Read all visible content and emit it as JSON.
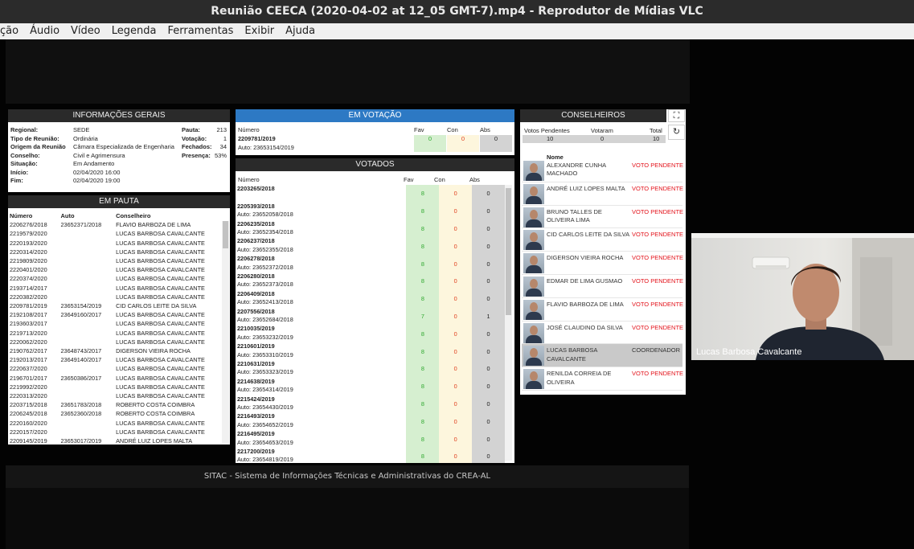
{
  "window": {
    "title": "Reunião CEECA (2020-04-02 at 12_05 GMT-7).mp4 - Reprodutor de Mídias VLC"
  },
  "menu": [
    "ção",
    "Áudio",
    "Vídeo",
    "Legenda",
    "Ferramentas",
    "Exibir",
    "Ajuda"
  ],
  "info": {
    "title": "INFORMAÇÕES GERAIS",
    "left": [
      {
        "label": "Regional:",
        "value": "SEDE"
      },
      {
        "label": "Tipo de Reunião:",
        "value": "Ordinária"
      },
      {
        "label": "Origem da Reunião",
        "value": "Câmara Especializada de Engenharia"
      },
      {
        "label": "Conselho:",
        "value": "Civil e Agrimensura"
      },
      {
        "label": "Situação:",
        "value": "Em Andamento"
      },
      {
        "label": "Início:",
        "value": "02/04/2020 16:00"
      },
      {
        "label": "Fim:",
        "value": "02/04/2020 19:00"
      }
    ],
    "right": [
      {
        "label": "Pauta:",
        "value": "213"
      },
      {
        "label": "Votação:",
        "value": "1"
      },
      {
        "label": "Fechados:",
        "value": "34"
      },
      {
        "label": "Presença:",
        "value": "53%"
      }
    ]
  },
  "pauta": {
    "title": "EM PAUTA",
    "headers": [
      "Número",
      "Auto",
      "Conselheiro"
    ],
    "rows": [
      [
        "2206276/2018",
        "23652371/2018",
        "FLAVIO BARBOZA DE LIMA"
      ],
      [
        "2219579/2020",
        "",
        "LUCAS BARBOSA CAVALCANTE"
      ],
      [
        "2220193/2020",
        "",
        "LUCAS BARBOSA CAVALCANTE"
      ],
      [
        "2220314/2020",
        "",
        "LUCAS BARBOSA CAVALCANTE"
      ],
      [
        "2219809/2020",
        "",
        "LUCAS BARBOSA CAVALCANTE"
      ],
      [
        "2220401/2020",
        "",
        "LUCAS BARBOSA CAVALCANTE"
      ],
      [
        "2220374/2020",
        "",
        "LUCAS BARBOSA CAVALCANTE"
      ],
      [
        "2193714/2017",
        "",
        "LUCAS BARBOSA CAVALCANTE"
      ],
      [
        "2220382/2020",
        "",
        "LUCAS BARBOSA CAVALCANTE"
      ],
      [
        "2209781/2019",
        "23653154/2019",
        "CID CARLOS LEITE DA SILVA"
      ],
      [
        "2192108/2017",
        "23649160/2017",
        "LUCAS BARBOSA CAVALCANTE"
      ],
      [
        "2193603/2017",
        "",
        "LUCAS BARBOSA CAVALCANTE"
      ],
      [
        "2219713/2020",
        "",
        "LUCAS BARBOSA CAVALCANTE"
      ],
      [
        "2220062/2020",
        "",
        "LUCAS BARBOSA CAVALCANTE"
      ],
      [
        "2190762/2017",
        "23648743/2017",
        "DIGERSON VIEIRA ROCHA"
      ],
      [
        "2192013/2017",
        "23649140/2017",
        "LUCAS BARBOSA CAVALCANTE"
      ],
      [
        "2220637/2020",
        "",
        "LUCAS BARBOSA CAVALCANTE"
      ],
      [
        "2196701/2017",
        "23650386/2017",
        "LUCAS BARBOSA CAVALCANTE"
      ],
      [
        "2219992/2020",
        "",
        "LUCAS BARBOSA CAVALCANTE"
      ],
      [
        "2220313/2020",
        "",
        "LUCAS BARBOSA CAVALCANTE"
      ],
      [
        "2203715/2018",
        "23651783/2018",
        "ROBERTO COSTA COIMBRA"
      ],
      [
        "2206245/2018",
        "23652360/2018",
        "ROBERTO COSTA COIMBRA"
      ],
      [
        "2220160/2020",
        "",
        "LUCAS BARBOSA CAVALCANTE"
      ],
      [
        "2220157/2020",
        "",
        "LUCAS BARBOSA CAVALCANTE"
      ],
      [
        "2209145/2019",
        "23653017/2019",
        "ANDRÉ LUIZ LOPES MALTA"
      ]
    ]
  },
  "votacao": {
    "title": "EM VOTAÇÃO",
    "headers": [
      "Número",
      "Fav",
      "Con",
      "Abs"
    ],
    "numero": "2209781/2019",
    "auto": "Auto: 23653154/2019",
    "fav": "0",
    "con": "0",
    "abs": "0"
  },
  "votados": {
    "title": "VOTADOS",
    "headers": [
      "Número",
      "Fav",
      "Con",
      "Abs"
    ],
    "rows": [
      [
        "2203265/2018",
        "",
        "8",
        "0",
        "0"
      ],
      [
        "2205393/2018",
        "Auto: 23652058/2018",
        "8",
        "0",
        "0"
      ],
      [
        "2206235/2018",
        "Auto: 23652354/2018",
        "8",
        "0",
        "0"
      ],
      [
        "2206237/2018",
        "Auto: 23652355/2018",
        "8",
        "0",
        "0"
      ],
      [
        "2206278/2018",
        "Auto: 23652372/2018",
        "8",
        "0",
        "0"
      ],
      [
        "2206280/2018",
        "Auto: 23652373/2018",
        "8",
        "0",
        "0"
      ],
      [
        "2206409/2018",
        "Auto: 23652413/2018",
        "8",
        "0",
        "0"
      ],
      [
        "2207556/2018",
        "Auto: 23652684/2018",
        "7",
        "0",
        "1"
      ],
      [
        "2210035/2019",
        "Auto: 23653232/2019",
        "8",
        "0",
        "0"
      ],
      [
        "2210601/2019",
        "Auto: 23653310/2019",
        "8",
        "0",
        "0"
      ],
      [
        "2210631/2019",
        "Auto: 23653323/2019",
        "8",
        "0",
        "0"
      ],
      [
        "2214638/2019",
        "Auto: 23654314/2019",
        "8",
        "0",
        "0"
      ],
      [
        "2215424/2019",
        "Auto: 23654430/2019",
        "8",
        "0",
        "0"
      ],
      [
        "2216493/2019",
        "Auto: 23654652/2019",
        "8",
        "0",
        "0"
      ],
      [
        "2216495/2019",
        "Auto: 23654653/2019",
        "8",
        "0",
        "0"
      ],
      [
        "2217200/2019",
        "Auto: 23654819/2019",
        "8",
        "0",
        "0"
      ]
    ]
  },
  "conselheiros": {
    "title": "CONSELHEIROS",
    "headers": [
      "Votos Pendentes",
      "Votaram",
      "Total"
    ],
    "values": [
      "10",
      "0",
      "10"
    ],
    "name_header": "Nome",
    "members": [
      {
        "name": "ALEXANDRE CUNHA MACHADO",
        "status": "VOTO PENDENTE"
      },
      {
        "name": "ANDRÉ LUIZ LOPES MALTA",
        "status": "VOTO PENDENTE"
      },
      {
        "name": "BRUNO TALLES DE OLIVEIRA LIMA",
        "status": "VOTO PENDENTE"
      },
      {
        "name": "CID CARLOS LEITE DA SILVA",
        "status": "VOTO PENDENTE"
      },
      {
        "name": "DIGERSON VIEIRA ROCHA",
        "status": "VOTO PENDENTE"
      },
      {
        "name": "EDMAR DE LIMA GUSMAO",
        "status": "VOTO PENDENTE"
      },
      {
        "name": "FLAVIO BARBOZA DE LIMA",
        "status": "VOTO PENDENTE"
      },
      {
        "name": "JOSÉ CLAUDINO DA SILVA",
        "status": "VOTO PENDENTE"
      },
      {
        "name": "LUCAS BARBOSA CAVALCANTE",
        "status": "COORDENADOR"
      },
      {
        "name": "RENILDA CORREIA DE OLIVEIRA",
        "status": "VOTO PENDENTE"
      }
    ]
  },
  "footer": "SITAC - Sistema de Informações Técnicas e Administrativas do CREA-AL",
  "webcam": {
    "name": "Lucas Barbosa Cavalcante"
  }
}
